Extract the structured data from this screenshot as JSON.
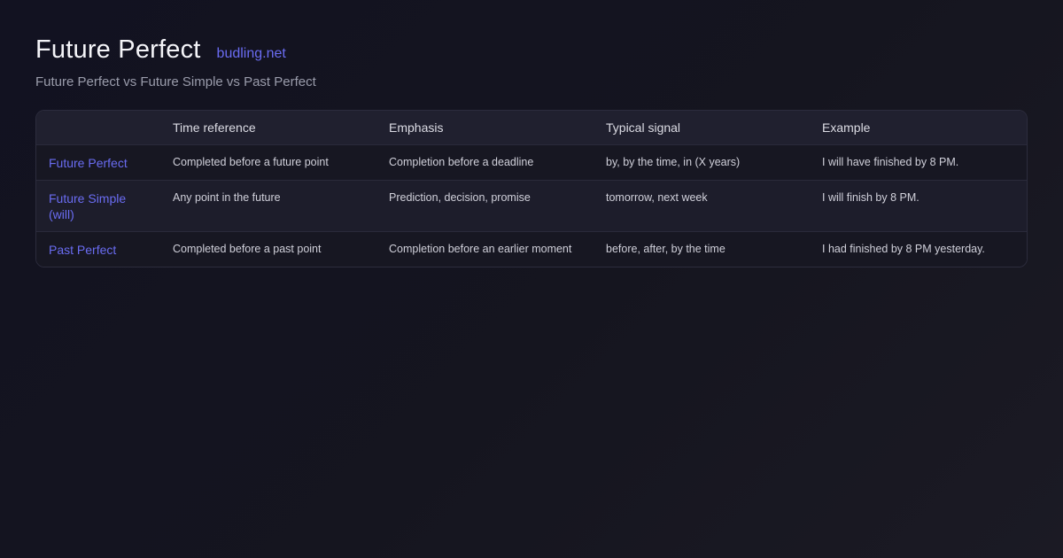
{
  "header": {
    "title": "Future Perfect",
    "site": "budling.net",
    "subtitle": "Future Perfect vs Future Simple vs Past Perfect"
  },
  "table": {
    "columns": [
      "",
      "Time reference",
      "Emphasis",
      "Typical signal",
      "Example"
    ],
    "rows": [
      {
        "tense": "Future Perfect",
        "time_reference": "Completed before a future point",
        "emphasis": "Completion before a deadline",
        "typical_signal": "by, by the time, in (X years)",
        "example": "I will have finished by 8 PM."
      },
      {
        "tense": "Future Simple (will)",
        "time_reference": "Any point in the future",
        "emphasis": "Prediction, decision, promise",
        "typical_signal": "tomorrow, next week",
        "example": "I will finish by 8 PM."
      },
      {
        "tense": "Past Perfect",
        "time_reference": "Completed before a past point",
        "emphasis": "Completion before an earlier moment",
        "typical_signal": "before, after, by the time",
        "example": "I had finished by 8 PM yesterday."
      }
    ]
  },
  "colors": {
    "accent": "#6a6cf2",
    "background": "#14141f",
    "header_row": "#20202f",
    "border": "#2c2c3d"
  }
}
